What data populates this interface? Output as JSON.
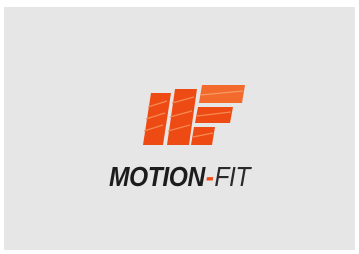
{
  "logo": {
    "icon": "motion-fit-stripes-logo",
    "wordmark_bold": "MOTION",
    "wordmark_dash": "-",
    "wordmark_light": "FIT",
    "colors": {
      "brand_orange": "#ee4b14",
      "brand_orange_light": "#f26a2c",
      "text_dark": "#1c1c1c",
      "background": "#e6e6e6"
    }
  }
}
